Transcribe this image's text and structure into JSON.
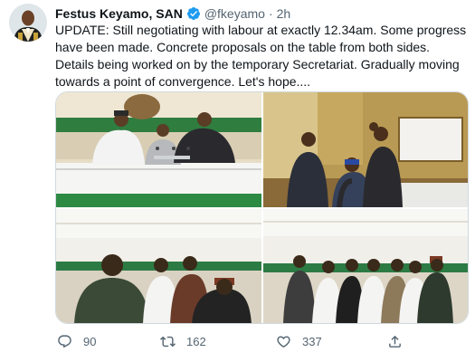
{
  "author": {
    "name": "Festus Keyamo, SAN",
    "handle": "@fkeyamo",
    "separator": "·",
    "time": "2h"
  },
  "tweet": {
    "text": "UPDATE: Still negotiating with labour at exactly 12.34am. Some progress have been made. Concrete proposals on the table from both sides. Details being worked on by the temporary Secretariat. Gradually moving towards a point of convergence. Let's hope...."
  },
  "media": {
    "photos": [
      {
        "subject": "men-at-table-photo"
      },
      {
        "subject": "men-standing-in-office-photo"
      },
      {
        "subject": "men-in-hall-photo"
      },
      {
        "subject": "group-in-hall-photo"
      }
    ]
  },
  "actions": {
    "reply_count": "90",
    "retweet_count": "162",
    "like_count": "337"
  },
  "icons": {
    "verified": "verified-badge-icon",
    "reply": "reply-icon",
    "retweet": "retweet-icon",
    "like": "heart-icon",
    "share": "share-icon"
  },
  "colors": {
    "verified": "#1d9bf0",
    "muted": "#536471",
    "text": "#0f1419"
  }
}
